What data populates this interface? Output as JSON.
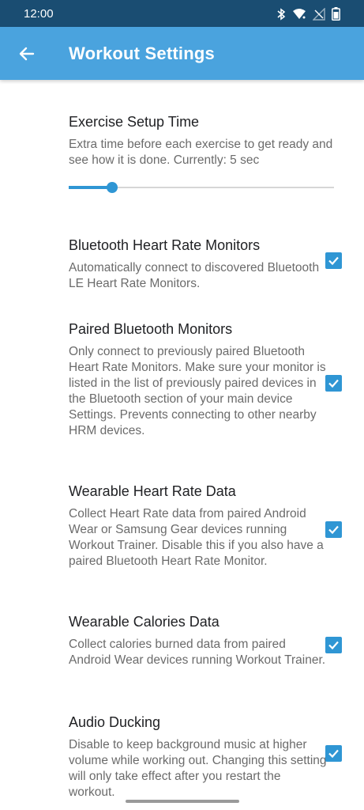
{
  "status": {
    "time": "12:00"
  },
  "appbar": {
    "title": "Workout Settings"
  },
  "setup_time": {
    "title": "Exercise Setup Time",
    "description": "Extra time before each exercise to get ready and see how it is done. Currently: 5 sec",
    "slider_fraction": 0.165
  },
  "settings": [
    {
      "title": "Bluetooth Heart Rate Monitors",
      "description": "Automatically connect to discovered Bluetooth LE Heart Rate Monitors.",
      "checked": true
    },
    {
      "title": "Paired Bluetooth Monitors",
      "description": "Only connect to previously paired Bluetooth Heart Rate Monitors. Make sure your monitor is listed in the list of previously paired devices in the Bluetooth section of your main device Settings. Prevents connecting to other nearby HRM devices.",
      "checked": true
    },
    {
      "title": "Wearable Heart Rate Data",
      "description": "Collect Heart Rate data from paired Android Wear or Samsung Gear devices running Workout Trainer. Disable this if you also have a paired Bluetooth Heart Rate Monitor.",
      "checked": true
    },
    {
      "title": "Wearable Calories Data",
      "description": "Collect calories burned data from paired Android Wear devices running Workout Trainer.",
      "checked": true
    },
    {
      "title": "Audio Ducking",
      "description": "Disable to keep background music at higher volume while working out. Changing this setting will only take effect after you restart the workout.",
      "checked": true
    }
  ],
  "colors": {
    "status_bar": "#1a4d72",
    "app_bar": "#4aa3de",
    "accent": "#2f96d4"
  },
  "icons": [
    "back-arrow-icon",
    "bluetooth-icon",
    "wifi-icon",
    "no-signal-icon",
    "battery-icon",
    "check-icon"
  ]
}
